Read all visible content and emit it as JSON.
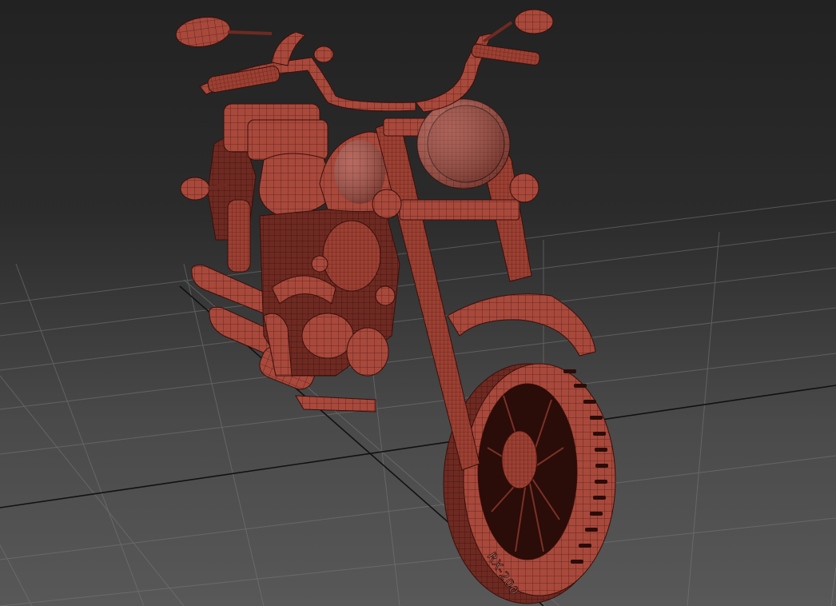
{
  "viewport": {
    "background_top": "#222222",
    "background_bottom": "#585858",
    "grid_color": "#7a7a7a",
    "grid_axis_color": "#111111",
    "model_color": "#a8493c",
    "wire_color": "#3a0f0a"
  },
  "model": {
    "tire_label": "RX-200"
  }
}
